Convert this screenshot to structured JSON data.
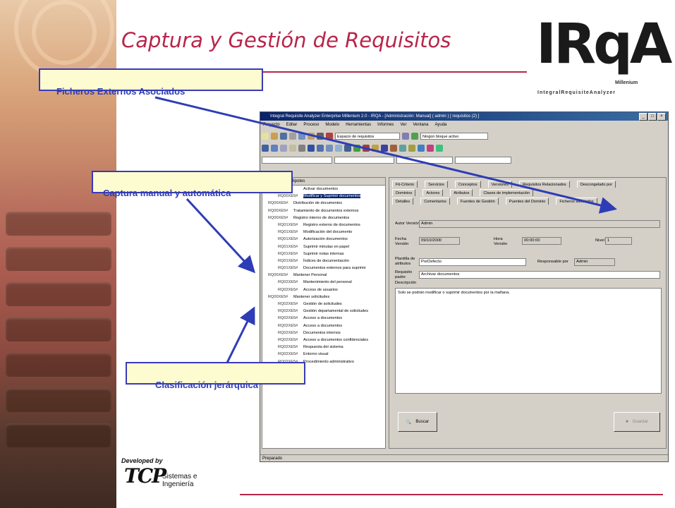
{
  "slide": {
    "title": "Captura y Gestión de Requisitos",
    "logo": {
      "text": "IRqA",
      "tagline": "IntegralRequisiteAnalyzer",
      "edition": "Millenium"
    },
    "footer": {
      "developed_by": "Developed by",
      "brand": "TCP",
      "company": "Sistemas e Ingeniería"
    },
    "callouts": [
      "Ficheros Externos Asociados",
      "Captura manual y automática",
      "Clasificación jerárquica"
    ],
    "accent_color": "#b8254a",
    "callout_text_color": "#2e3db5"
  },
  "app": {
    "window_title": "Integral Requisite Analyzer Enterprise Millenium 2.0 - IRQA - [Administración: Manual] ( admin ) [ requisitos (2) ]",
    "menu": [
      "Proyecto",
      "Editar",
      "Proceso",
      "Modelo",
      "Herramientas",
      "Informes",
      "Ver",
      "Ventana",
      "Ayuda"
    ],
    "toolbar": {
      "filter_combo": "Espacio de requisitos",
      "block_combo": "Ningún bloque activo"
    },
    "tree": {
      "header": "Hipotes",
      "rows": [
        {
          "code": "",
          "label": "Activar documentos"
        },
        {
          "code": "RQ00XE5#",
          "label": "Modificar y Suprimir documentos",
          "selected": true
        },
        {
          "code": "RQ00XE5#",
          "label": "Distribución de documentos"
        },
        {
          "code": "RQ00XE5#",
          "label": "Tratamiento de documentos externos"
        },
        {
          "code": "RQ00XE5#",
          "label": "Registro interno de documentos"
        },
        {
          "code": "RQ01XE5#",
          "label": "Registro externo de documentos"
        },
        {
          "code": "RQ01XE5#",
          "label": "Modificación del documento"
        },
        {
          "code": "RQ01XE5#",
          "label": "Autorización documentos"
        },
        {
          "code": "RQ01XE5#",
          "label": "Suprimir minutas en papel"
        },
        {
          "code": "RQ01XE5#",
          "label": "Suprimir notas internas"
        },
        {
          "code": "RQ01XE5#",
          "label": "Índices de documentación"
        },
        {
          "code": "RQ01XE5#",
          "label": "Documentos externos para suprimir"
        },
        {
          "code": "RQ00XE5#",
          "label": "Mantener Personal"
        },
        {
          "code": "RQ02XE5#",
          "label": "Mantenimiento del personal"
        },
        {
          "code": "RQ02XE5#",
          "label": "Acceso de usuarios"
        },
        {
          "code": "RQ00XE5#",
          "label": "Mantener solicitudes"
        },
        {
          "code": "RQ02XE5#",
          "label": "Gestión de solicitudes"
        },
        {
          "code": "RQ02XE5#",
          "label": "Gestión departamental de solicitudes"
        },
        {
          "code": "RQ02XE5#",
          "label": "Acceso a documentos"
        },
        {
          "code": "RQ02XE5#",
          "label": "Acceso a documentos"
        },
        {
          "code": "RQ02XE5#",
          "label": "Documentos internos"
        },
        {
          "code": "RQ02XE5#",
          "label": "Acceso a documentos confidenciales"
        },
        {
          "code": "RQ02XE5#",
          "label": "Respuesta del sistema"
        },
        {
          "code": "RQ02XE5#",
          "label": "Entorno visual"
        },
        {
          "code": "RQ02XE5#",
          "label": "Procedimiento administrativo"
        }
      ]
    },
    "tabs_row1": [
      "Fti-Criterio",
      "Servicios",
      "Conceptos",
      "Versiones",
      "Requisitos Relacionados",
      "Descongelado por"
    ],
    "tabs_row2": [
      "Dominios",
      "Actores",
      "Atributos",
      "Clases de implementación"
    ],
    "tabs_row3": [
      "Detalles",
      "Comentarios",
      "Fuentes de Gestión",
      "Puentes del Dominio",
      "Ficheros asociados"
    ],
    "fields": {
      "autor_label": "Autor Versión",
      "autor_value": "Admin",
      "fecha_label": "Fecha Versión",
      "fecha_value": "09/10/2000",
      "hora_label": "Hora Versión",
      "hora_value": "00:00:00",
      "nivel_label": "Nivel",
      "nivel_value": "1",
      "plantilla_label": "Plantilla de atributos",
      "plantilla_value": "PorDefecto",
      "responsable_label": "Responsable por",
      "responsable_value": "Admin",
      "padre_label": "Requisito padre",
      "padre_value": "Archivar documentos",
      "descripcion_label": "Descripción",
      "descripcion_value": "Solo se podrán modificar o suprimir documentos por la mañana."
    },
    "buttons": {
      "search": "Buscar",
      "save": "Guardar"
    },
    "status": "Preparado"
  }
}
